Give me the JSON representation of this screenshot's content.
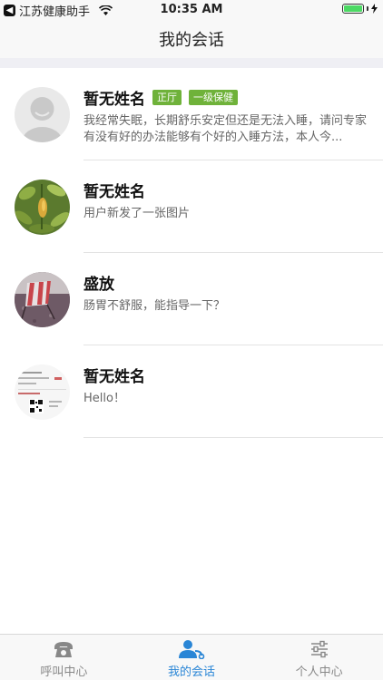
{
  "status_bar": {
    "carrier": "江苏健康助手",
    "time": "10:35 AM",
    "battery_percent": 100
  },
  "header": {
    "title": "我的会话"
  },
  "conversations": [
    {
      "name": "暂无姓名",
      "tags": [
        "正厅",
        "一级保健"
      ],
      "message": "我经常失眠，长期舒乐安定但还是无法入睡，请问专家有没有好的办法能够有个好的入睡方法，本人今...",
      "avatar": "default-avatar-icon"
    },
    {
      "name": "暂无姓名",
      "tags": [],
      "message": "用户新发了一张图片",
      "avatar": "plant-photo"
    },
    {
      "name": "盛放",
      "tags": [],
      "message": "肠胃不舒服，能指导一下？",
      "avatar": "deck-chair-photo"
    },
    {
      "name": "暂无姓名",
      "tags": [],
      "message": "Hello！",
      "avatar": "qr-screenshot-photo"
    }
  ],
  "tabs": [
    {
      "label": "呼叫中心",
      "icon": "phone-icon",
      "active": false
    },
    {
      "label": "我的会话",
      "icon": "doctor-icon",
      "active": true
    },
    {
      "label": "个人中心",
      "icon": "sliders-icon",
      "active": false
    }
  ],
  "colors": {
    "accent": "#2a86d6",
    "tag": "#6fb23a",
    "battery": "#4cd964"
  }
}
